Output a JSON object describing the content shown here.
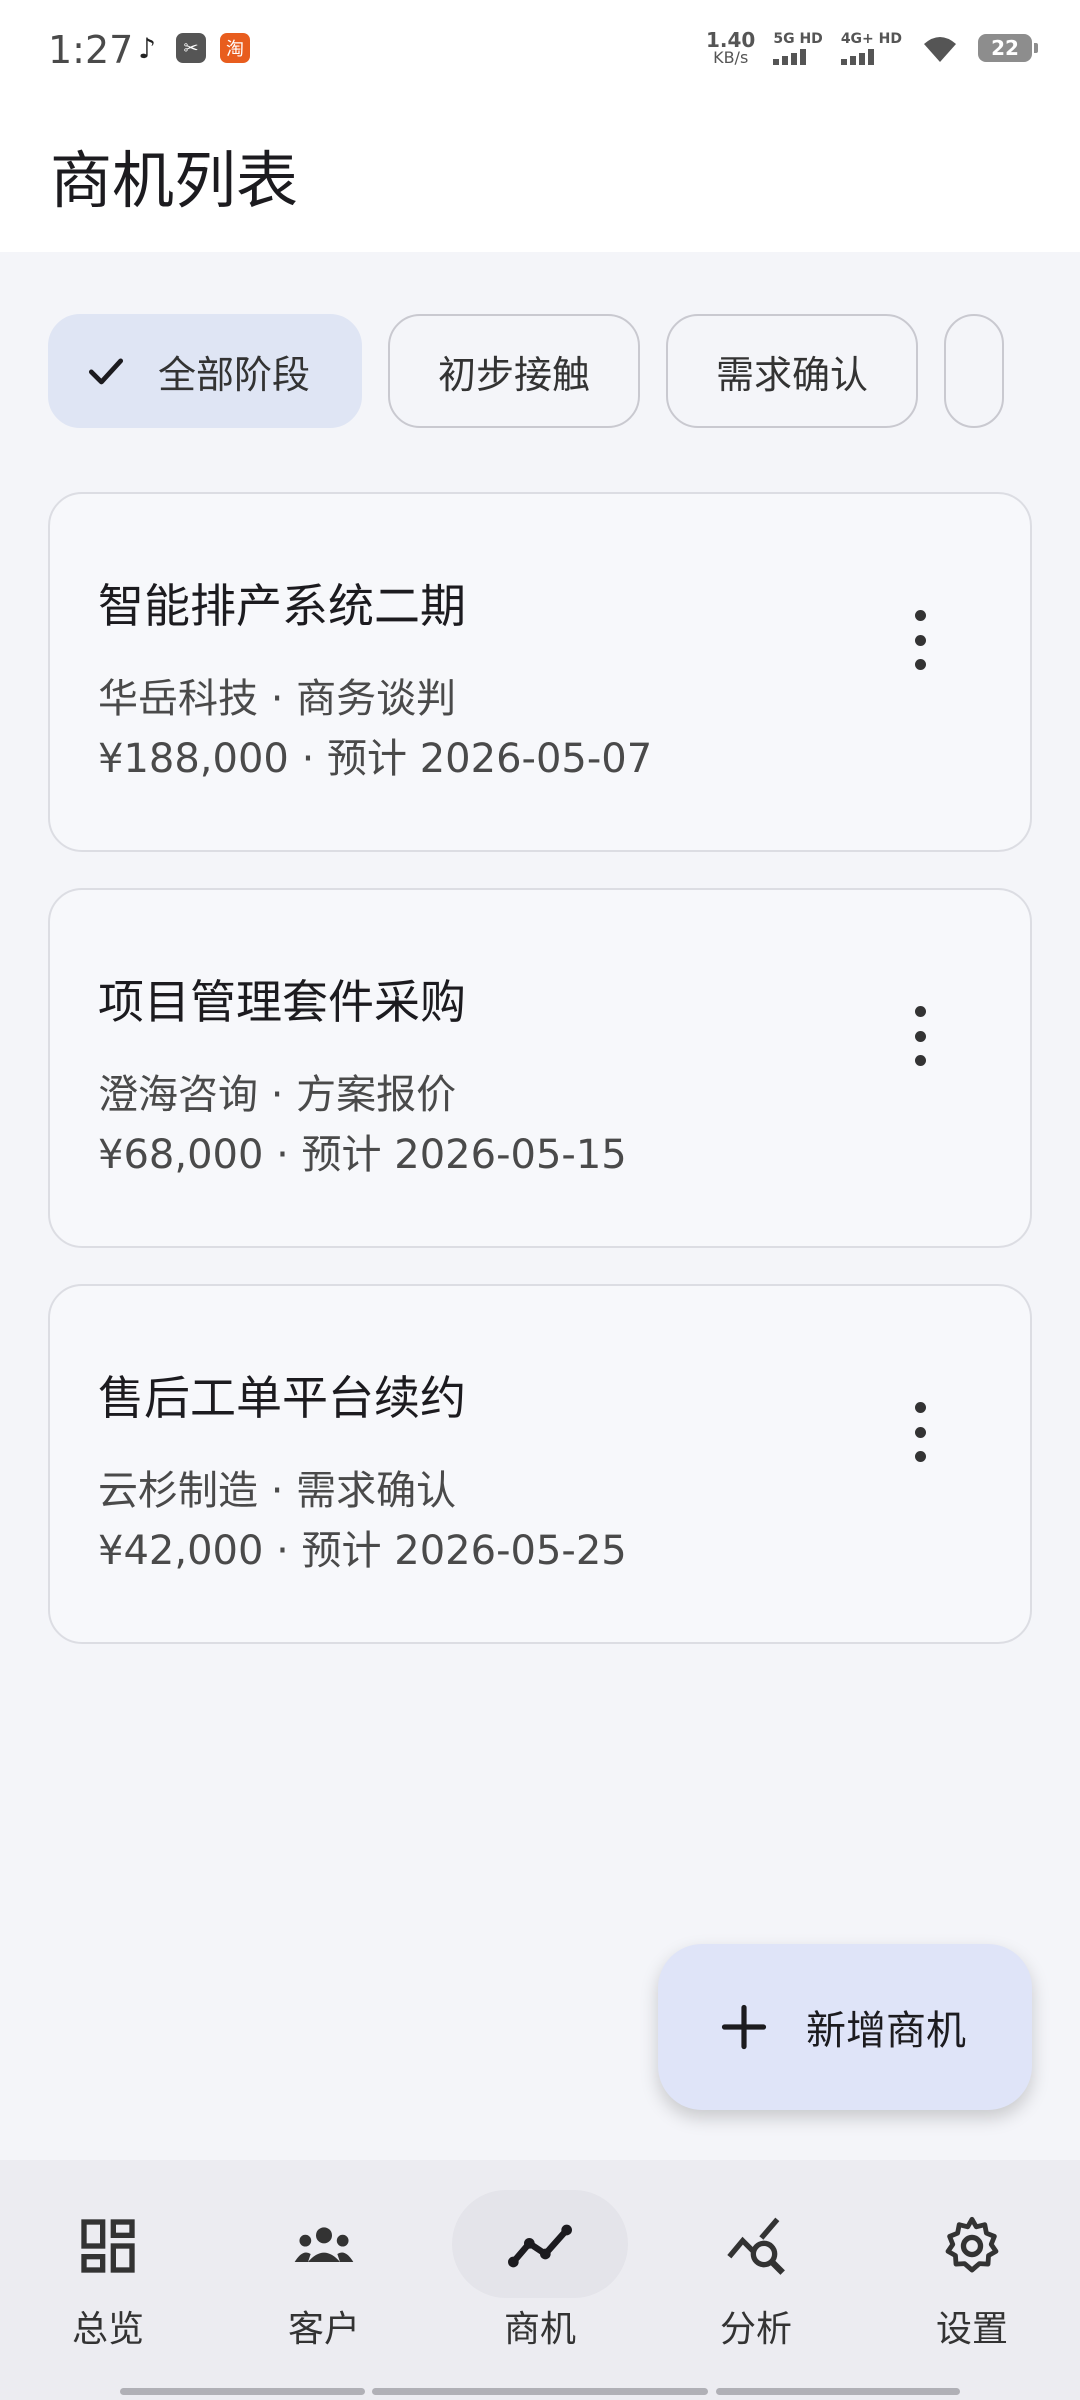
{
  "status_bar": {
    "time": "1:27",
    "net_speed_value": "1.40",
    "net_speed_unit": "KB/s",
    "sim1_label": "5G HD",
    "sim2_label": "4G+ HD",
    "battery": "22",
    "app_icons": [
      "tiktok-icon",
      "scissors-app-icon",
      "taobao-icon"
    ],
    "taobao_glyph": "淘"
  },
  "header": {
    "title": "商机列表"
  },
  "filters": {
    "chips": [
      {
        "label": "全部阶段",
        "selected": true
      },
      {
        "label": "初步接触",
        "selected": false
      },
      {
        "label": "需求确认",
        "selected": false
      }
    ]
  },
  "opportunities": [
    {
      "title": "智能排产系统二期",
      "meta": "华岳科技 · 商务谈判",
      "amount_line": "¥188,000 · 预计 2026-05-07"
    },
    {
      "title": "项目管理套件采购",
      "meta": "澄海咨询 · 方案报价",
      "amount_line": "¥68,000 · 预计 2026-05-15"
    },
    {
      "title": "售后工单平台续约",
      "meta": "云杉制造 · 需求确认",
      "amount_line": "¥42,000 · 预计 2026-05-25"
    }
  ],
  "fab": {
    "label": "新增商机",
    "icon": "plus-icon"
  },
  "bottom_nav": {
    "items": [
      {
        "label": "总览",
        "icon": "dashboard-icon",
        "active": false
      },
      {
        "label": "客户",
        "icon": "people-icon",
        "active": false
      },
      {
        "label": "商机",
        "icon": "trend-line-icon",
        "active": true
      },
      {
        "label": "分析",
        "icon": "analytics-search-icon",
        "active": false
      },
      {
        "label": "设置",
        "icon": "gear-icon",
        "active": false
      }
    ]
  },
  "colors": {
    "background": "#f4f5f9",
    "selected_chip": "#dfe5f4",
    "fab": "#dfe4f8",
    "nav_background": "#ececf1"
  }
}
